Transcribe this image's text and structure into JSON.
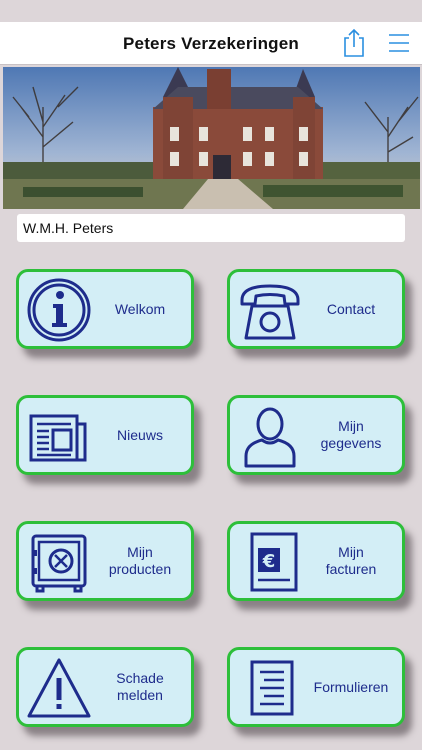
{
  "header": {
    "title": "Peters Verzekeringen",
    "share_icon": "share-icon",
    "menu_icon": "hamburger-menu-icon"
  },
  "user": {
    "name": "W.M.H. Peters"
  },
  "colors": {
    "background": "#ddd6d9",
    "tile_fill": "#d3eef6",
    "tile_border": "#2dbf3a",
    "icon_color": "#1e2c8c",
    "header_icon": "#2a8fe0"
  },
  "tiles": [
    {
      "label": "Welkom",
      "icon": "info-icon"
    },
    {
      "label": "Contact",
      "icon": "telephone-icon"
    },
    {
      "label": "Nieuws",
      "icon": "newspaper-icon"
    },
    {
      "label": "Mijn\ngegevens",
      "icon": "person-icon"
    },
    {
      "label": "Mijn\nproducten",
      "icon": "safe-icon"
    },
    {
      "label": "Mijn\nfacturen",
      "icon": "invoice-euro-icon"
    },
    {
      "label": "Schade\nmelden",
      "icon": "warning-icon"
    },
    {
      "label": "Formulieren",
      "icon": "document-icon"
    }
  ]
}
